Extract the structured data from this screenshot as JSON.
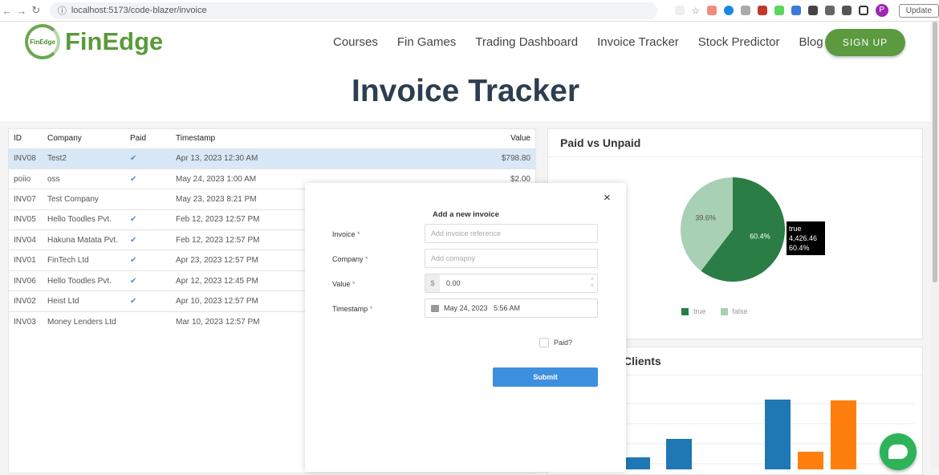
{
  "browser": {
    "url": "localhost:5173/code-blazer/invoice",
    "update_label": "Update",
    "profile_initial": "P"
  },
  "nav": {
    "brand": "FinEdge",
    "logo_text": "FinEdge",
    "items": [
      "Courses",
      "Fin Games",
      "Trading Dashboard",
      "Invoice Tracker",
      "Stock Predictor",
      "Blog"
    ],
    "signup": "SIGN UP"
  },
  "page": {
    "title": "Invoice Tracker"
  },
  "table": {
    "headers": [
      "ID",
      "Company",
      "Paid",
      "Timestamp",
      "Value"
    ],
    "rows": [
      {
        "id": "INV08",
        "company": "Test2",
        "paid": "✔",
        "timestamp": "Apr 13, 2023 12:30 AM",
        "value": "$798.80"
      },
      {
        "id": "poiio",
        "company": "oss",
        "paid": "✔",
        "timestamp": "May 24, 2023 1:00 AM",
        "value": "$2.00"
      },
      {
        "id": "INV07",
        "company": "Test Company",
        "paid": "",
        "timestamp": "May 23, 2023 8:21 PM",
        "value": ""
      },
      {
        "id": "INV05",
        "company": "Hello Toodles Pvt.",
        "paid": "✔",
        "timestamp": "Feb 12, 2023 12:57 PM",
        "value": ""
      },
      {
        "id": "INV04",
        "company": "Hakuna Matata Pvt.",
        "paid": "✔",
        "timestamp": "Feb 12, 2023 12:57 PM",
        "value": ""
      },
      {
        "id": "INV01",
        "company": "FinTech Ltd",
        "paid": "✔",
        "timestamp": "Apr 23, 2023 12:57 PM",
        "value": ""
      },
      {
        "id": "INV06",
        "company": "Hello Toodles Pvt.",
        "paid": "✔",
        "timestamp": "Apr 12, 2023 12:45 PM",
        "value": ""
      },
      {
        "id": "INV02",
        "company": "Heist Ltd",
        "paid": "✔",
        "timestamp": "Apr 10, 2023 12:57 PM",
        "value": ""
      },
      {
        "id": "INV03",
        "company": "Money Lenders Ltd",
        "paid": "",
        "timestamp": "Mar 10, 2023 12:57 PM",
        "value": ""
      }
    ]
  },
  "modal": {
    "title": "Add a new invoice",
    "close": "×",
    "invoice_label": "Invoice",
    "invoice_placeholder": "Add invoice reference",
    "company_label": "Company",
    "company_placeholder": "Add comapny",
    "value_label": "Value",
    "value_prefix": "$",
    "value": "0.00",
    "timestamp_label": "Timestamp",
    "timestamp_value": "May 24, 2023   5:56 AM",
    "required": "*",
    "paid_label": "Paid?",
    "submit": "Submit"
  },
  "chart_data": [
    {
      "type": "pie",
      "title": "Paid vs Unpaid",
      "slices": [
        {
          "name": "true",
          "percent": 60.4,
          "label": "60.4%",
          "color": "#2a7d45"
        },
        {
          "name": "false",
          "percent": 39.6,
          "label": "39.6%",
          "color": "#a8d0b4"
        }
      ],
      "tooltip": {
        "name": "true",
        "value": "4,426.46",
        "percent": "60.4%"
      },
      "legend": [
        "true",
        "false"
      ]
    },
    {
      "type": "bar",
      "title": "Clients",
      "series": [
        {
          "color": "#1f77b4",
          "values": [
            15,
            38,
            87
          ]
        },
        {
          "color": "#ff7f0e",
          "values": [
            22,
            86
          ]
        }
      ]
    }
  ]
}
